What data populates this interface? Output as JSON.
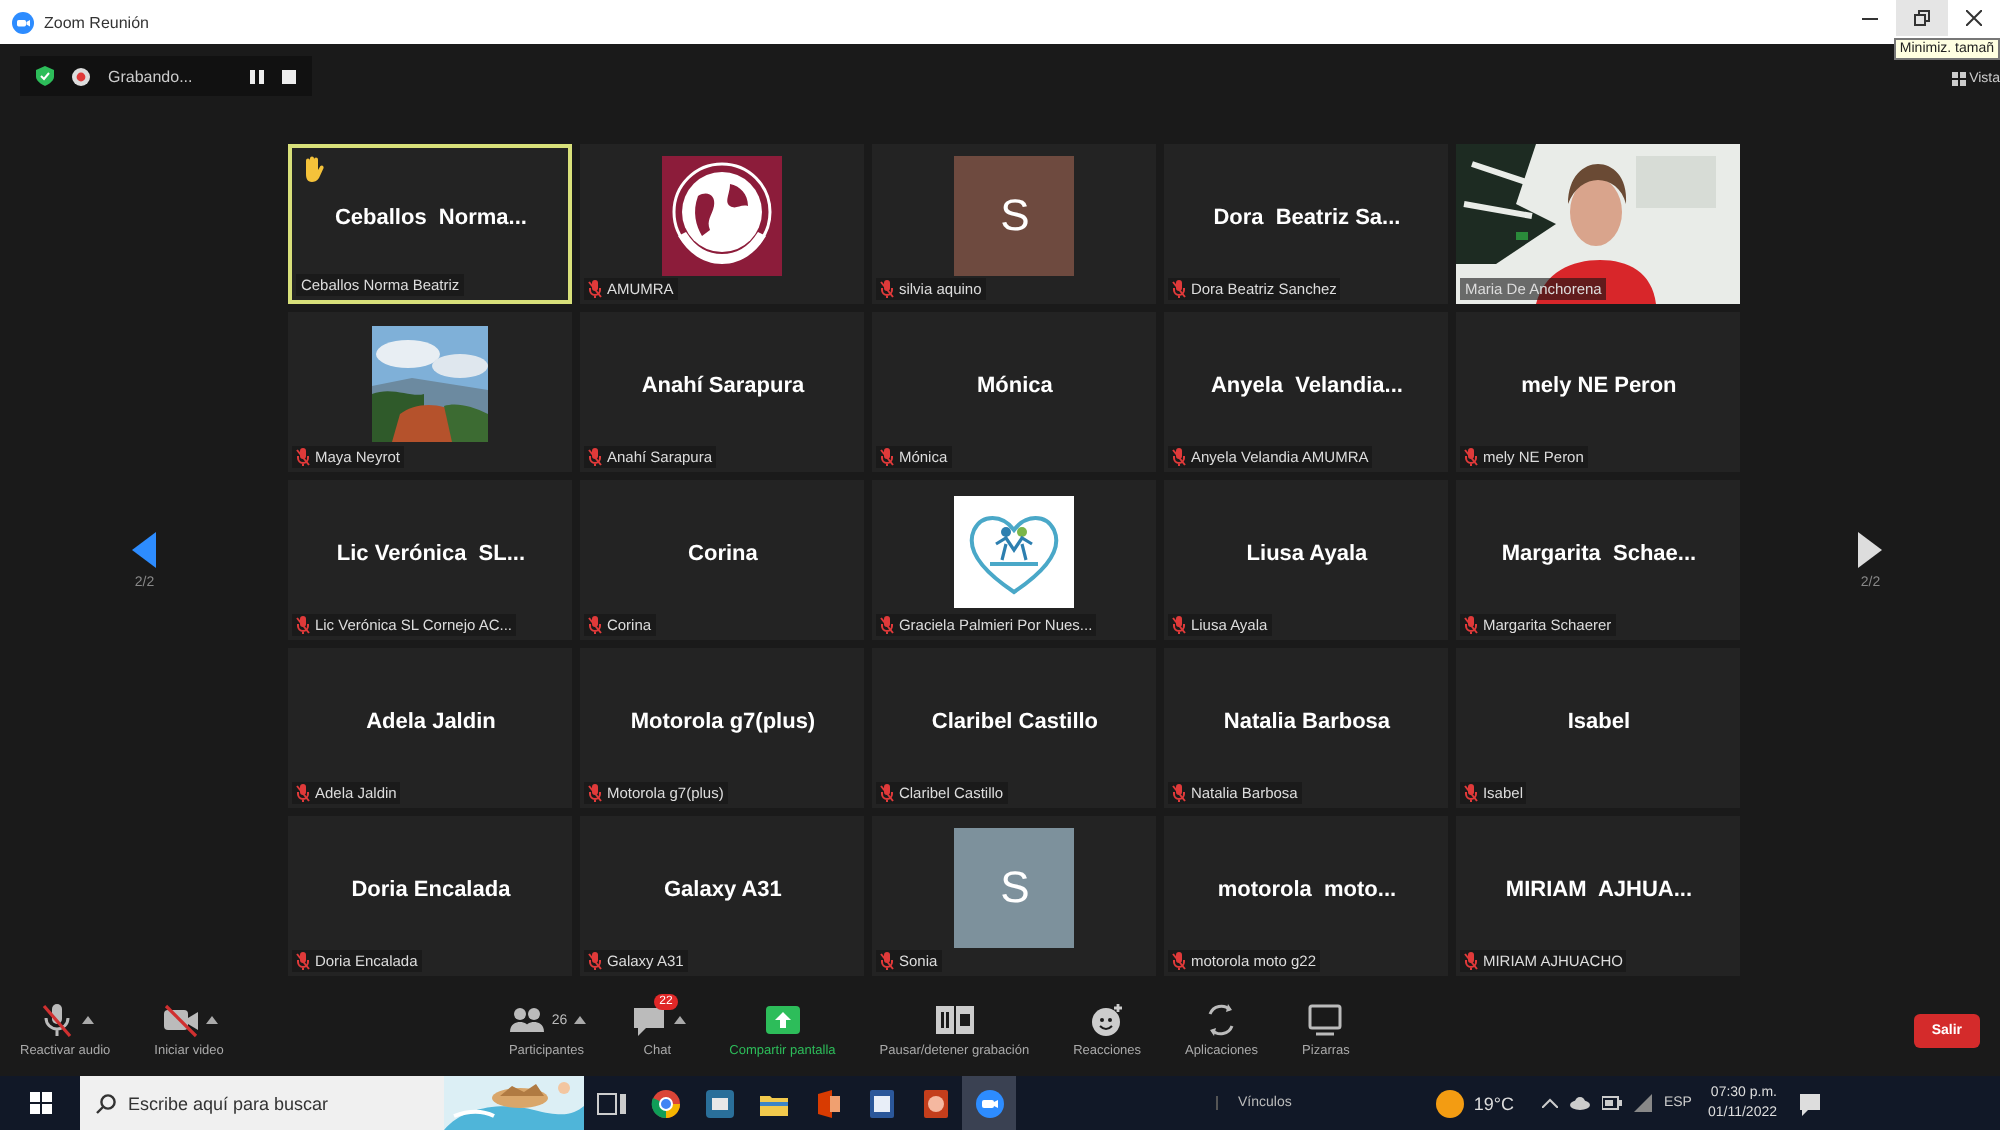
{
  "window": {
    "title": "Zoom Reunión",
    "tooltip": "Minimiz. tamañ"
  },
  "recording": {
    "label": "Grabando..."
  },
  "view_button": {
    "label": "Vista"
  },
  "pager": {
    "left": "2/2",
    "right": "2/2"
  },
  "tiles": [
    {
      "kind": "name",
      "name": "Ceballos  Norma...",
      "label": "Ceballos Norma Beatriz",
      "muted": false,
      "speaking": true,
      "hand_raised": true
    },
    {
      "kind": "globe-logo",
      "label": "AMUMRA",
      "muted": true,
      "speaking": false,
      "hand_raised": false
    },
    {
      "kind": "letter",
      "letter": "S",
      "color": "#6e4a3f",
      "label": "silvia aquino",
      "muted": true,
      "speaking": false,
      "hand_raised": false
    },
    {
      "kind": "name",
      "name": "Dora  Beatriz Sa...",
      "label": "Dora Beatriz Sanchez",
      "muted": true,
      "speaking": false,
      "hand_raised": false
    },
    {
      "kind": "video",
      "label": "Maria De Anchorena",
      "muted": false,
      "speaking": false,
      "hand_raised": false
    },
    {
      "label": "Maya Neyrot",
      "muted": true,
      "speaking": false,
      "hand_raised": false
    },
    {
      "kind": "name",
      "name": "Anahí Sarapura",
      "label": "Anahí Sarapura",
      "muted": true,
      "speaking": false,
      "hand_raised": false
    },
    {
      "kind": "name",
      "name": "Mónica",
      "label": "Mónica",
      "muted": true,
      "speaking": false,
      "hand_raised": false
    },
    {
      "kind": "name",
      "name": "Anyela  Velandia...",
      "label": "Anyela Velandia AMUMRA",
      "muted": true,
      "speaking": false,
      "hand_raised": false
    },
    {
      "kind": "name",
      "name": "mely NE Peron",
      "label": "mely NE Peron",
      "muted": true,
      "speaking": false,
      "hand_raised": false
    },
    {
      "kind": "name",
      "name": "Lic Verónica  SL...",
      "label": "Lic Verónica SL Cornejo AC...",
      "muted": true,
      "speaking": false,
      "hand_raised": false
    },
    {
      "kind": "name",
      "name": "Corina",
      "label": "Corina",
      "muted": true,
      "speaking": false,
      "hand_raised": false
    },
    {
      "kind": "heart-logo",
      "label": "Graciela Palmieri Por Nues...",
      "muted": true,
      "speaking": false,
      "hand_raised": false
    },
    {
      "kind": "name",
      "name": "Liusa Ayala",
      "label": "Liusa Ayala",
      "muted": true,
      "speaking": false,
      "hand_raised": false
    },
    {
      "kind": "name",
      "name": "Margarita  Schae...",
      "label": "Margarita Schaerer",
      "muted": true,
      "speaking": false,
      "hand_raised": false
    },
    {
      "kind": "name",
      "name": "Adela Jaldin",
      "label": "Adela Jaldin",
      "muted": true,
      "speaking": false,
      "hand_raised": false
    },
    {
      "kind": "name",
      "name": "Motorola g7(plus)",
      "label": "Motorola g7(plus)",
      "muted": true,
      "speaking": false,
      "hand_raised": false
    },
    {
      "kind": "name",
      "name": "Claribel Castillo",
      "label": "Claribel Castillo",
      "muted": true,
      "speaking": false,
      "hand_raised": false
    },
    {
      "kind": "name",
      "name": "Natalia Barbosa",
      "label": "Natalia Barbosa",
      "muted": true,
      "speaking": false,
      "hand_raised": false
    },
    {
      "kind": "name",
      "name": "Isabel",
      "label": "Isabel",
      "muted": true,
      "speaking": false,
      "hand_raised": false
    },
    {
      "kind": "name",
      "name": "Doria Encalada",
      "label": "Doria Encalada",
      "muted": true,
      "speaking": false,
      "hand_raised": false
    },
    {
      "kind": "name",
      "name": "Galaxy A31",
      "label": "Galaxy A31",
      "muted": true,
      "speaking": false,
      "hand_raised": false
    },
    {
      "kind": "letter",
      "letter": "S",
      "color": "#7d919c",
      "label": "Sonia",
      "muted": true,
      "speaking": false,
      "hand_raised": false
    },
    {
      "kind": "name",
      "name": "motorola  moto...",
      "label": "motorola moto g22",
      "muted": true,
      "speaking": false,
      "hand_raised": false
    },
    {
      "kind": "name",
      "name": "MIRIAM  AJHUA...",
      "label": "MIRIAM AJHUACHO",
      "muted": true,
      "speaking": false,
      "hand_raised": false
    }
  ],
  "toolbar": [
    {
      "kind": "audio",
      "label": "Reactivar audio",
      "caret": true
    },
    {
      "kind": "video",
      "label": "Iniciar video",
      "caret": true
    },
    {
      "kind": "participants",
      "label": "Participantes",
      "count": "26",
      "caret": true
    },
    {
      "kind": "chat",
      "label": "Chat",
      "badge": "22",
      "caret": true
    },
    {
      "kind": "share",
      "label": "Compartir pantalla",
      "caret": false
    },
    {
      "kind": "record",
      "label": "Pausar/detener grabación",
      "caret": false
    },
    {
      "kind": "reactions",
      "label": "Reacciones",
      "caret": false
    },
    {
      "kind": "apps",
      "label": "Aplicaciones",
      "caret": false
    },
    {
      "kind": "whiteboard",
      "label": "Pizarras",
      "caret": false
    }
  ],
  "leave_button": {
    "label": "Salir"
  },
  "taskbar": {
    "search_placeholder": "Escribe aquí para buscar",
    "links": "Vínculos",
    "temperature": "19°C",
    "language": "ESP",
    "time": "07:30 p.m.",
    "date": "01/11/2022"
  }
}
